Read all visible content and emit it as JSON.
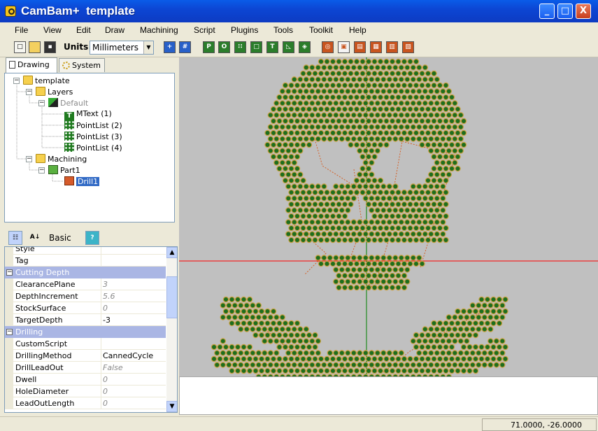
{
  "window": {
    "title": "CamBam+  template",
    "min": "_",
    "max": "□",
    "close": "X"
  },
  "menu": [
    "File",
    "View",
    "Edit",
    "Draw",
    "Machining",
    "Script",
    "Plugins",
    "Tools",
    "Toolkit",
    "Help"
  ],
  "toolbar": {
    "units_label": "Units",
    "units_value": "Millimeters"
  },
  "tabs": {
    "drawing": "Drawing",
    "system": "System"
  },
  "tree": {
    "root": "template",
    "layers": "Layers",
    "default_layer": "Default",
    "items": [
      "MText (1)",
      "PointList (2)",
      "PointList (3)",
      "PointList (4)"
    ],
    "machining": "Machining",
    "part": "Part1",
    "drill": "Drill1"
  },
  "props_toolbar": {
    "basic": "Basic",
    "help": "?"
  },
  "properties": [
    {
      "kind": "row",
      "name": "Style",
      "value": ""
    },
    {
      "kind": "row",
      "name": "Tag",
      "value": ""
    },
    {
      "kind": "cat",
      "name": "Cutting Depth"
    },
    {
      "kind": "row",
      "name": "ClearancePlane",
      "value": "3",
      "gray": true
    },
    {
      "kind": "row",
      "name": "DepthIncrement",
      "value": "5.6",
      "gray": true
    },
    {
      "kind": "row",
      "name": "StockSurface",
      "value": "0",
      "gray": true
    },
    {
      "kind": "row",
      "name": "TargetDepth",
      "value": "-3"
    },
    {
      "kind": "cat",
      "name": "Drilling"
    },
    {
      "kind": "row",
      "name": "CustomScript",
      "value": ""
    },
    {
      "kind": "row",
      "name": "DrillingMethod",
      "value": "CannedCycle"
    },
    {
      "kind": "row",
      "name": "DrillLeadOut",
      "value": "False",
      "gray": true
    },
    {
      "kind": "row",
      "name": "Dwell",
      "value": "0",
      "gray": true
    },
    {
      "kind": "row",
      "name": "HoleDiameter",
      "value": "0",
      "gray": true
    },
    {
      "kind": "row",
      "name": "LeadOutLength",
      "value": "0",
      "gray": true
    }
  ],
  "status": {
    "coords": "71.0000, -26.0000"
  },
  "colors": {
    "hole_fill": "#1e6e1e",
    "hole_ring": "#caa040",
    "toolpath": "#d4622a",
    "x_axis": "#ff0000",
    "y_axis": "#008000"
  }
}
